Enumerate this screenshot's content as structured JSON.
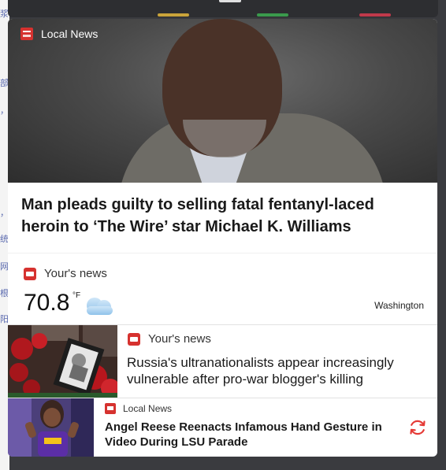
{
  "background_page": {
    "glyphs": [
      "浆",
      "部",
      "，",
      "，",
      "统",
      "网",
      "根",
      "阳"
    ]
  },
  "topbar": {
    "accent_colors": [
      "#c9a33a",
      "#3a9a4c",
      "#c0394b"
    ]
  },
  "hero": {
    "source_name": "Local News",
    "source_icon": "news-source-logo-icon",
    "headline": "Man pleads guilty to selling fatal fentanyl-laced heroin to ‘The Wire’ star Michael K. Williams"
  },
  "weather": {
    "source_name": "Your's news",
    "temperature": "70.8",
    "unit": "°F",
    "condition_icon": "partly-cloudy-icon",
    "city": "Washington"
  },
  "cards": [
    {
      "source_name": "Your's news",
      "title": "Russia's ultranationalists appear increasingly vulnerable after pro-war blogger's killing"
    },
    {
      "source_name": "Local News",
      "title": "Angel Reese Reenacts Infamous Hand Gesture in Video During LSU Parade",
      "action_icon": "refresh-icon"
    }
  ],
  "colors": {
    "brand_red": "#d6322f",
    "refresh_red": "#e53935"
  }
}
